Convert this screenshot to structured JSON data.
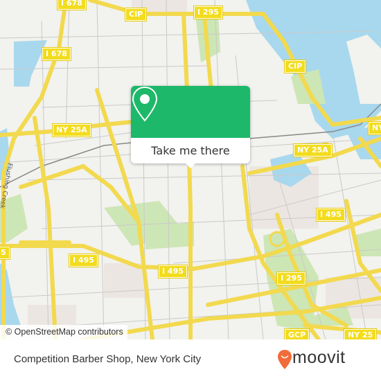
{
  "map": {
    "road_labels": [
      {
        "id": "i678-top",
        "text": "I 678"
      },
      {
        "id": "cip-top",
        "text": "CIP"
      },
      {
        "id": "i295-top",
        "text": "I 295"
      },
      {
        "id": "i678-mid",
        "text": "I 678"
      },
      {
        "id": "cip-right",
        "text": "CIP"
      },
      {
        "id": "ny25a-left",
        "text": "NY 25A"
      },
      {
        "id": "ny25a-right",
        "text": "NY 25A"
      },
      {
        "id": "ny-far-right",
        "text": "NY"
      },
      {
        "id": "i495-left",
        "text": "I 495"
      },
      {
        "id": "i495-center",
        "text": "I 495"
      },
      {
        "id": "i495-right",
        "text": "I 495"
      },
      {
        "id": "i295-bottom",
        "text": "I 295"
      },
      {
        "id": "gcp",
        "text": "GCP"
      },
      {
        "id": "ny25",
        "text": "NY 25"
      },
      {
        "id": "edge-left-5",
        "text": "5"
      }
    ],
    "street_label": "Flushing Creek",
    "colors": {
      "highway": "#f7e35e",
      "water": "#a8d8ee",
      "park": "#cde6b5",
      "land": "#f2f2ee",
      "residential": "#ece6e2"
    }
  },
  "popup": {
    "button_label": "Take me there",
    "icon": "map-pin-icon",
    "color": "#1db869"
  },
  "attribution": "© OpenStreetMap contributors",
  "footer": {
    "place": "Competition Barber Shop, New York City",
    "brand": "moovit",
    "brand_color": "#f26b3a"
  }
}
